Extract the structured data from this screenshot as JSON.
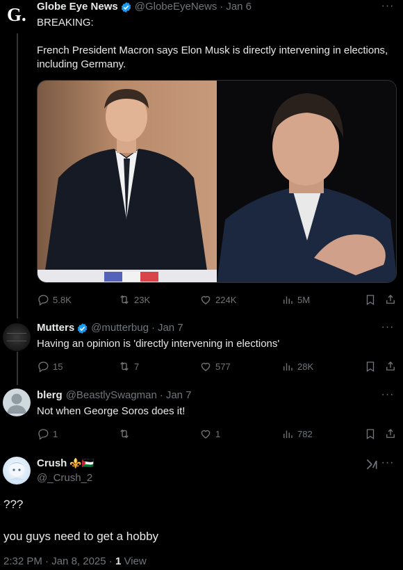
{
  "tweets": [
    {
      "name": "Globe Eye News",
      "handle": "@GlobeEyeNews",
      "date": "Jan 6",
      "text_lines": [
        "BREAKING:",
        "",
        "French President Macron says Elon Musk is directly intervening in elections,",
        "including Germany."
      ],
      "replies": "5.8K",
      "reposts": "23K",
      "likes": "224K",
      "views": "5M"
    },
    {
      "name": "Mutters",
      "handle": "@mutterbug",
      "date": "Jan 7",
      "text": "Having an opinion is 'directly intervening in elections'",
      "replies": "15",
      "reposts": "7",
      "likes": "577",
      "views": "28K"
    },
    {
      "name": "blerg",
      "handle": "@BeastlySwagman",
      "date": "Jan 7",
      "text": "Not when George Soros does it!",
      "replies": "1",
      "reposts": "",
      "likes": "1",
      "views": "782"
    }
  ],
  "main": {
    "name": "Crush",
    "name_emoji": "⚜️🇵🇸",
    "handle": "@_Crush_2",
    "line1": "???",
    "line2": "you guys need to get a hobby",
    "time": "2:32 PM",
    "date": "Jan 8, 2025",
    "views_count": "1",
    "views_label": "View"
  },
  "avatar_letter": "G.",
  "more_label": "···",
  "dot": "·",
  "colors": {
    "background": "#000000",
    "text": "#e7e9ea",
    "muted": "#71767b",
    "verified": "#1d9bf0"
  },
  "icons": [
    "reply-icon",
    "repost-icon",
    "like-icon",
    "views-icon",
    "bookmark-icon",
    "share-icon",
    "verified-icon",
    "grok-icon",
    "more-icon"
  ]
}
